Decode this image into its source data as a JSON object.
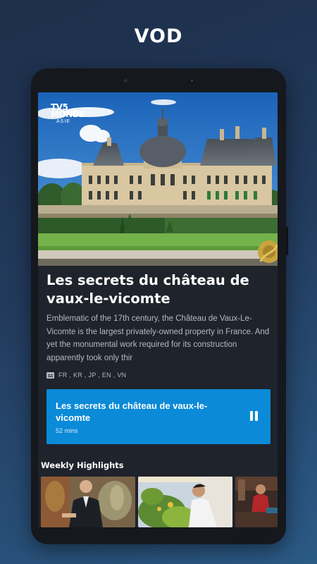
{
  "header": {
    "title": "VOD"
  },
  "hero": {
    "logo_main": "TV5\nMONDE",
    "logo_sub": "ASIE"
  },
  "program": {
    "title": "Les secrets du château de vaux-le-vicomte",
    "description": "Emblematic of the 17th century, the Château de Vaux-Le-Vicomte is the largest privately-owned property in France. And yet the monumental work required for its construction apparently took only thir",
    "languages": "FR , KR , JP , EN , VN",
    "languages_icon": "subtitles-icon"
  },
  "player": {
    "title": "Les secrets du château de vaux-le-vicomte",
    "duration": "52 mins",
    "control_icon": "pause-icon",
    "color": "#0b8ad8"
  },
  "highlights": {
    "title": "Weekly Highlights",
    "items": [
      {
        "icon": "thumbnail-man-in-suit"
      },
      {
        "icon": "thumbnail-man-with-plants"
      },
      {
        "icon": "thumbnail-man-in-workshop"
      }
    ]
  }
}
